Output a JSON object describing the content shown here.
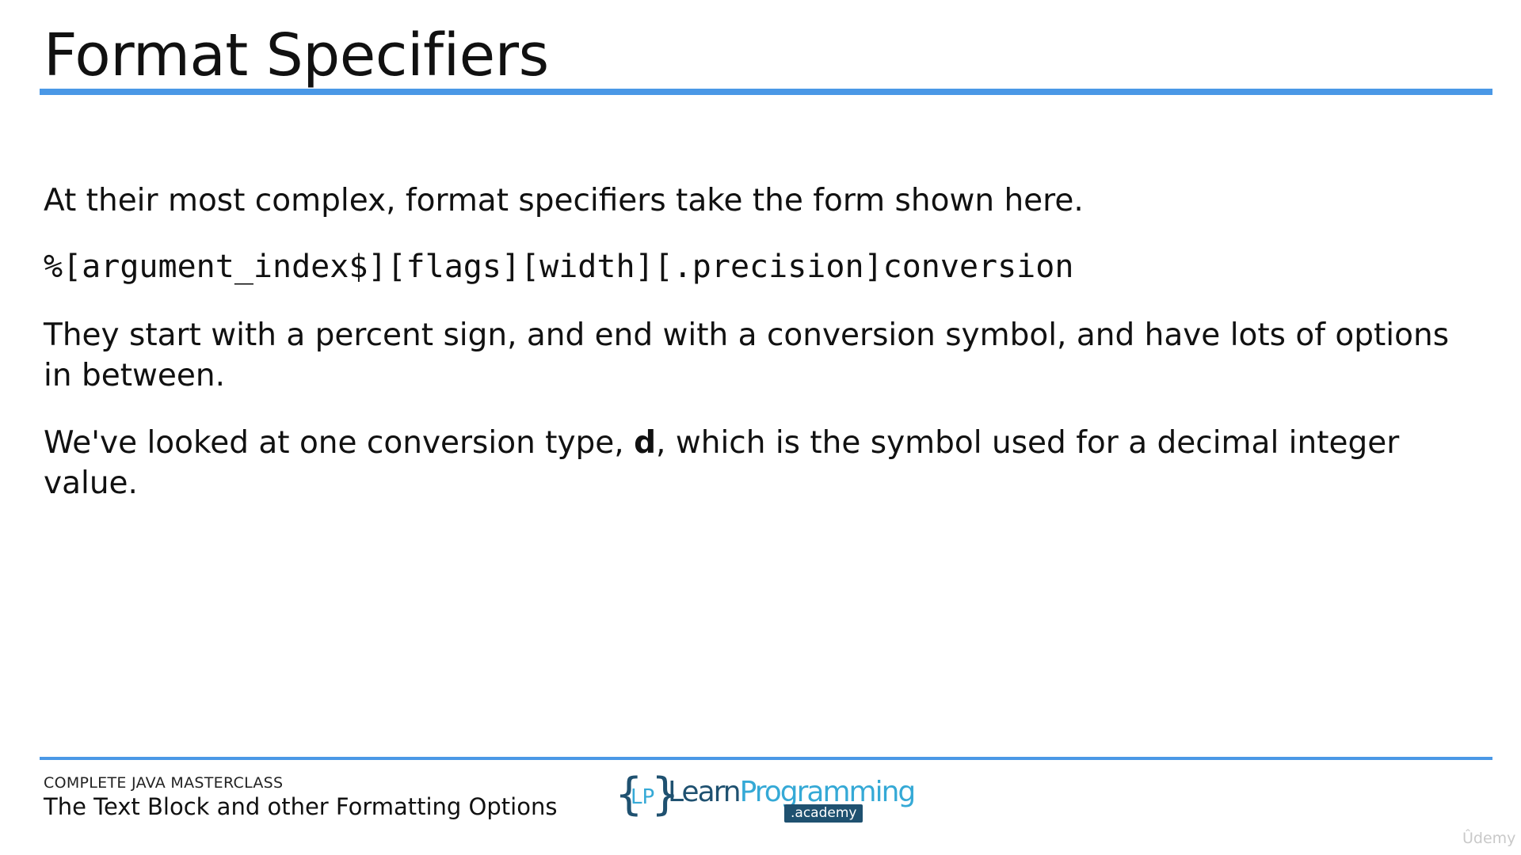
{
  "slide": {
    "title": "Format Specifiers",
    "paragraph1": "At their most complex, format specifiers take the form shown here.",
    "code_line": "%[argument_index$][flags][width][.precision]conversion",
    "paragraph2": "They start with a percent sign, and end with a conversion symbol, and have lots of options in between.",
    "paragraph3_before": "We've looked at one conversion type, ",
    "paragraph3_bold": "d",
    "paragraph3_after": ", which is the symbol used for a decimal integer value."
  },
  "footer": {
    "course": "COMPLETE JAVA MASTERCLASS",
    "lecture": "The Text Block and other Formatting Options",
    "logo": {
      "brace_left": "{",
      "monogram": "LP",
      "brace_right": "}",
      "word_learn": "Learn",
      "word_programming": "Programming",
      "academy": ".academy"
    },
    "watermark": "Ûdemy"
  },
  "colors": {
    "accent_rule": "#4a98e6",
    "logo_dark": "#1f5170",
    "logo_light": "#35a9d6"
  }
}
